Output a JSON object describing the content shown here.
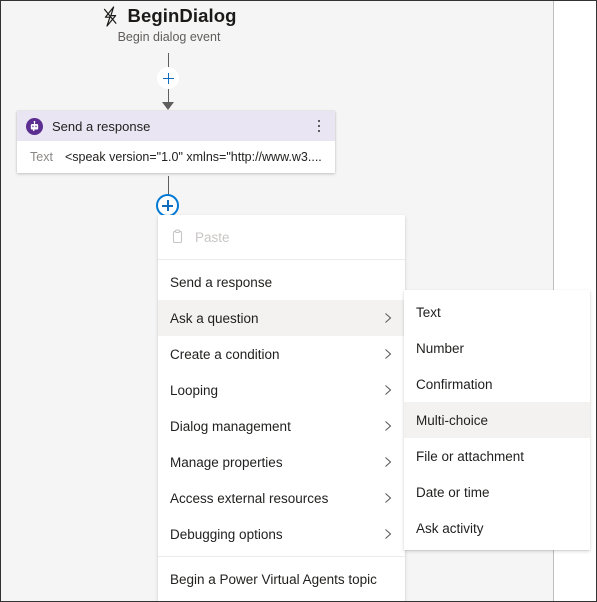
{
  "canvas": {
    "trigger": {
      "icon": "lightning-bolt-icon",
      "title": "BeginDialog",
      "subtitle": "Begin dialog event"
    },
    "add_node_buttons": [
      {
        "name": "add-node-button-top",
        "glyph": "plus-icon",
        "state": "default"
      },
      {
        "name": "add-node-button-active",
        "glyph": "plus-icon",
        "state": "active"
      }
    ],
    "card": {
      "icon": "bot-icon",
      "title": "Send a response",
      "menu_icon": "kebab-menu-icon",
      "field_label": "Text",
      "field_value": "<speak version=\"1.0\" xmlns=\"http://www.w3...."
    }
  },
  "context_menu": {
    "items": [
      {
        "label": "Paste",
        "icon": "clipboard-icon",
        "disabled": true,
        "submenu": false,
        "selected": false
      },
      {
        "label": "Send a response",
        "disabled": false,
        "submenu": false,
        "selected": false
      },
      {
        "label": "Ask a question",
        "disabled": false,
        "submenu": true,
        "selected": true
      },
      {
        "label": "Create a condition",
        "disabled": false,
        "submenu": true,
        "selected": false
      },
      {
        "label": "Looping",
        "disabled": false,
        "submenu": true,
        "selected": false
      },
      {
        "label": "Dialog management",
        "disabled": false,
        "submenu": true,
        "selected": false
      },
      {
        "label": "Manage properties",
        "disabled": false,
        "submenu": true,
        "selected": false
      },
      {
        "label": "Access external resources",
        "disabled": false,
        "submenu": true,
        "selected": false
      },
      {
        "label": "Debugging options",
        "disabled": false,
        "submenu": true,
        "selected": false
      },
      {
        "label": "Begin a Power Virtual Agents topic",
        "disabled": false,
        "submenu": false,
        "selected": false
      }
    ]
  },
  "submenu": {
    "items": [
      {
        "label": "Text",
        "selected": false
      },
      {
        "label": "Number",
        "selected": false
      },
      {
        "label": "Confirmation",
        "selected": false
      },
      {
        "label": "Multi-choice",
        "selected": true
      },
      {
        "label": "File or attachment",
        "selected": false
      },
      {
        "label": "Date or time",
        "selected": false
      },
      {
        "label": "Ask activity",
        "selected": false
      }
    ]
  },
  "colors": {
    "canvas_bg": "#f5f5f5",
    "accent_blue": "#0f6cbd",
    "card_header": "#e9e5f2",
    "bot_purple": "#5c2e91",
    "selected_row": "#f3f2f1"
  }
}
